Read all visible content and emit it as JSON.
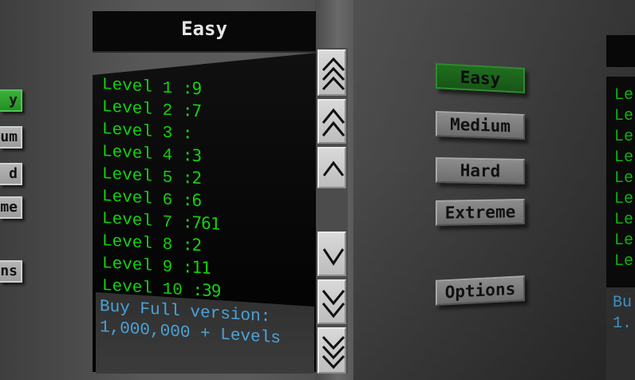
{
  "title": "Easy",
  "levels": [
    {
      "label": "Level",
      "num": "1",
      "value": ":9"
    },
    {
      "label": "Level",
      "num": "2",
      "value": ":7"
    },
    {
      "label": "Level",
      "num": "3",
      "value": ":"
    },
    {
      "label": "Level",
      "num": "4",
      "value": ":3"
    },
    {
      "label": "Level",
      "num": "5",
      "value": ":2"
    },
    {
      "label": "Level",
      "num": "6",
      "value": ":6"
    },
    {
      "label": "Level",
      "num": "7",
      "value": ":761"
    },
    {
      "label": "Level",
      "num": "8",
      "value": ":2"
    },
    {
      "label": "Level",
      "num": "9",
      "value": ":11"
    },
    {
      "label": "Level",
      "num": "10",
      "value": ":39"
    }
  ],
  "promo": {
    "line1": "Buy Full version:",
    "line2": "1,000,000 + Levels"
  },
  "scroll_buttons": [
    {
      "name": "scroll-top-button",
      "icon": "triple-chevron-up-icon"
    },
    {
      "name": "page-up-button",
      "icon": "double-chevron-up-icon"
    },
    {
      "name": "line-up-button",
      "icon": "chevron-up-icon"
    },
    {
      "name": "line-down-button",
      "icon": "chevron-down-icon"
    },
    {
      "name": "page-down-button",
      "icon": "double-chevron-down-icon"
    },
    {
      "name": "scroll-bottom-button",
      "icon": "triple-chevron-down-icon"
    }
  ],
  "left_menu": {
    "easy_partial": "y",
    "medium_partial": "um",
    "hard_partial": "d",
    "extreme_partial": "me",
    "options_partial": "ns"
  },
  "menu": {
    "easy": "Easy",
    "medium": "Medium",
    "hard": "Hard",
    "extreme": "Extreme",
    "options": "Options"
  },
  "far_right": {
    "rows": [
      "Le",
      "Le",
      "Le",
      "Le",
      "Le",
      "Le",
      "Le",
      "Le",
      "Le"
    ],
    "buy_1": "Bu",
    "buy_2": "1."
  },
  "colors": {
    "level_text": "#11d011",
    "promo_text": "#4aa3d8",
    "active_button": "#248f24"
  }
}
